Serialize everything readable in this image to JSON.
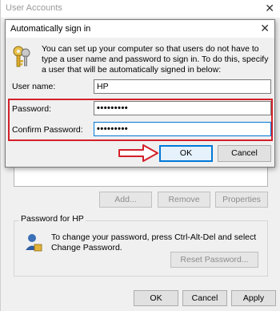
{
  "background_window": {
    "title": "User Accounts",
    "close_glyph": "✕",
    "buttons": {
      "add": "Add...",
      "remove": "Remove",
      "properties": "Properties"
    },
    "password_group": {
      "label": "Password for HP",
      "text": "To change your password, press Ctrl-Alt-Del and select Change Password.",
      "reset_button": "Reset Password..."
    },
    "footer_buttons": {
      "ok": "OK",
      "cancel": "Cancel",
      "apply": "Apply"
    }
  },
  "dialog": {
    "title": "Automatically sign in",
    "close_glyph": "✕",
    "description": "You can set up your computer so that users do not have to type a user name and password to sign in. To do this, specify a user that will be automatically signed in below:",
    "fields": {
      "user_name_label": "User name:",
      "user_name_value": "HP",
      "password_label": "Password:",
      "password_value": "•••••••••",
      "confirm_password_label": "Confirm Password:",
      "confirm_password_value": "•••••••••"
    },
    "buttons": {
      "ok": "OK",
      "cancel": "Cancel"
    }
  },
  "colors": {
    "highlight_red": "#d3202a",
    "focus_blue": "#0078d7"
  }
}
